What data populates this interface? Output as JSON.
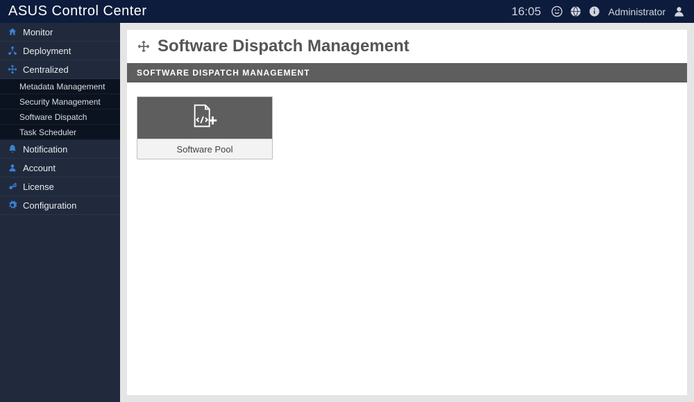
{
  "topbar": {
    "title": "ASUS Control Center",
    "time": "16:05",
    "user_label": "Administrator"
  },
  "sidebar": {
    "items": [
      {
        "label": "Monitor"
      },
      {
        "label": "Deployment"
      },
      {
        "label": "Centralized",
        "active": true
      },
      {
        "label": "Notification"
      },
      {
        "label": "Account"
      },
      {
        "label": "License"
      },
      {
        "label": "Configuration"
      }
    ],
    "centralized_subitems": [
      {
        "label": "Metadata Management"
      },
      {
        "label": "Security Management"
      },
      {
        "label": "Software Dispatch"
      },
      {
        "label": "Task Scheduler"
      }
    ]
  },
  "page": {
    "title": "Software Dispatch Management",
    "section_bar": "SOFTWARE DISPATCH MANAGEMENT"
  },
  "card": {
    "label": "Software Pool"
  }
}
